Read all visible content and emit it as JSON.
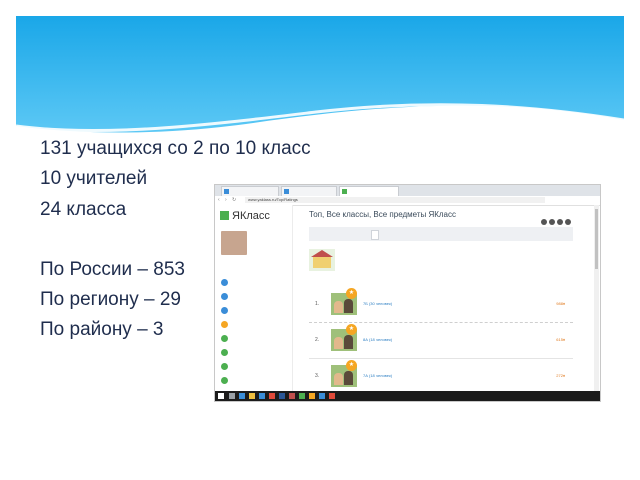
{
  "slide": {
    "bullets": [
      "131 учащихся со 2 по 10 класс",
      "10 учителей",
      " 24 класса",
      "По России – 853",
      "По региону – 29",
      "По району – 3"
    ]
  },
  "browser": {
    "tabs": [
      "",
      "",
      ""
    ],
    "address": "www.yaklass.ru/Top/Ratings"
  },
  "site": {
    "logo": "ЯКласс",
    "page_title": "Топ, Все классы, Все предметы ЯКласс",
    "user": {
      "name_lines": [
        "",
        "",
        ""
      ],
      "link": ""
    },
    "menu": [
      {
        "label": "",
        "color": "#3a8dd8"
      },
      {
        "label": "",
        "color": "#3a8dd8"
      },
      {
        "label": "",
        "color": "#3a8dd8"
      },
      {
        "label": "",
        "color": "#f5a623"
      },
      {
        "label": "",
        "color": "#4caf50"
      },
      {
        "label": "",
        "color": "#4caf50"
      },
      {
        "label": "",
        "color": "#4caf50"
      },
      {
        "label": "",
        "color": "#4caf50"
      }
    ],
    "filters": [
      "",
      "",
      ""
    ],
    "school": {
      "lines": [
        "",
        "",
        ""
      ]
    },
    "choose_link": "",
    "rankings": [
      {
        "num": "1.",
        "name": "7Б (30 человек)",
        "score": "988♦"
      },
      {
        "num": "2.",
        "name": "8А (18 человек)",
        "score": "615♦"
      },
      {
        "num": "3.",
        "name": "7А (18 человек)",
        "score": "272♦"
      }
    ]
  },
  "taskbar": {
    "tray": ""
  },
  "colors": {
    "header_gradient_top": "#1aa7e8",
    "header_gradient_bottom": "#4fc4f3",
    "bullet_text": "#1f2d4d",
    "accent_green": "#4caf50",
    "link_blue": "#2d7fc3",
    "score_orange": "#e07a1f"
  }
}
